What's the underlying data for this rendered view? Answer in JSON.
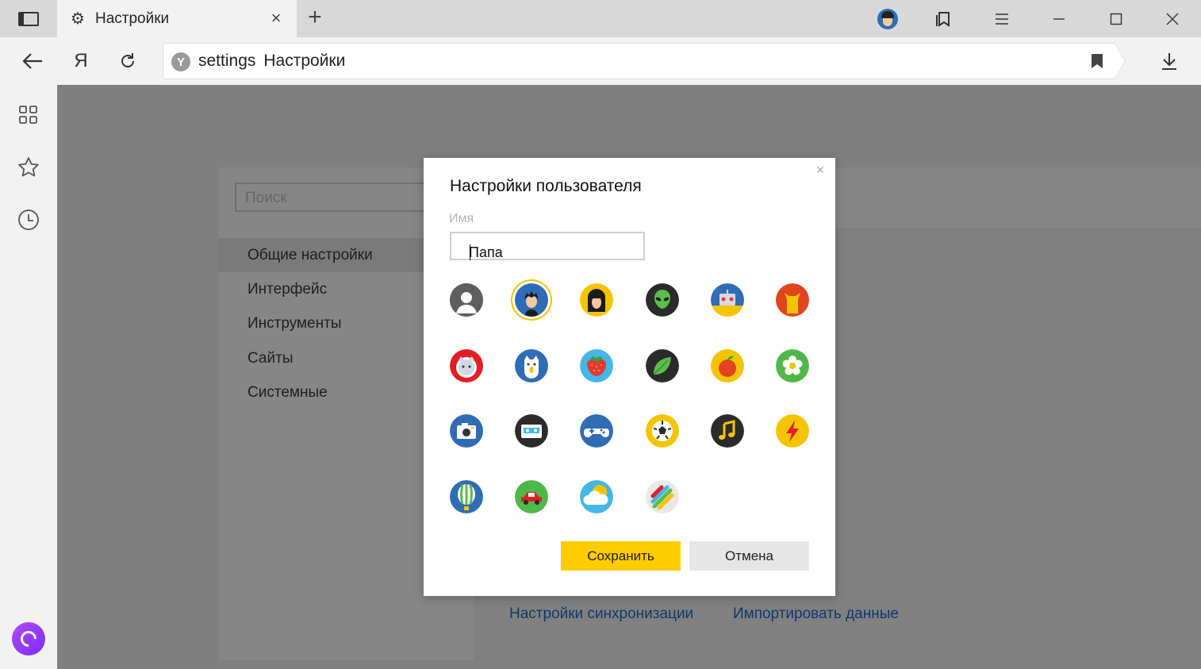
{
  "browser": {
    "tab_title": "Настройки",
    "address_host": "settings",
    "address_title": "Настройки",
    "yandex_button_label": "Я"
  },
  "settings_page": {
    "search_placeholder": "Поиск",
    "nav_items": [
      "Общие настройки",
      "Интерфейс",
      "Инструменты",
      "Сайты",
      "Системные"
    ],
    "active_nav_item": "Общие настройки",
    "links": [
      "Настройки синхронизации",
      "Импортировать данные"
    ]
  },
  "modal": {
    "title": "Настройки пользователя",
    "name_label": "Имя",
    "name_value": "Папа",
    "save_label": "Сохранить",
    "cancel_label": "Отмена",
    "selected_avatar": "boy-avatar",
    "avatars": [
      "default-person-avatar",
      "boy-avatar",
      "girl-avatar",
      "alien-avatar",
      "robot-avatar",
      "cat-avatar",
      "cat-face-avatar",
      "dog-avatar",
      "strawberry-avatar",
      "leaf-avatar",
      "apple-avatar",
      "flower-avatar",
      "camera-avatar",
      "cassette-avatar",
      "gamepad-avatar",
      "soccer-ball-avatar",
      "music-note-avatar",
      "lightning-avatar",
      "balloon-avatar",
      "car-avatar",
      "cloud-avatar",
      "stripes-avatar"
    ]
  },
  "colors": {
    "save_button": "#ffcc00",
    "selection_ring": "#f5c400",
    "link": "#12376b",
    "alice": "#9b3cff"
  }
}
